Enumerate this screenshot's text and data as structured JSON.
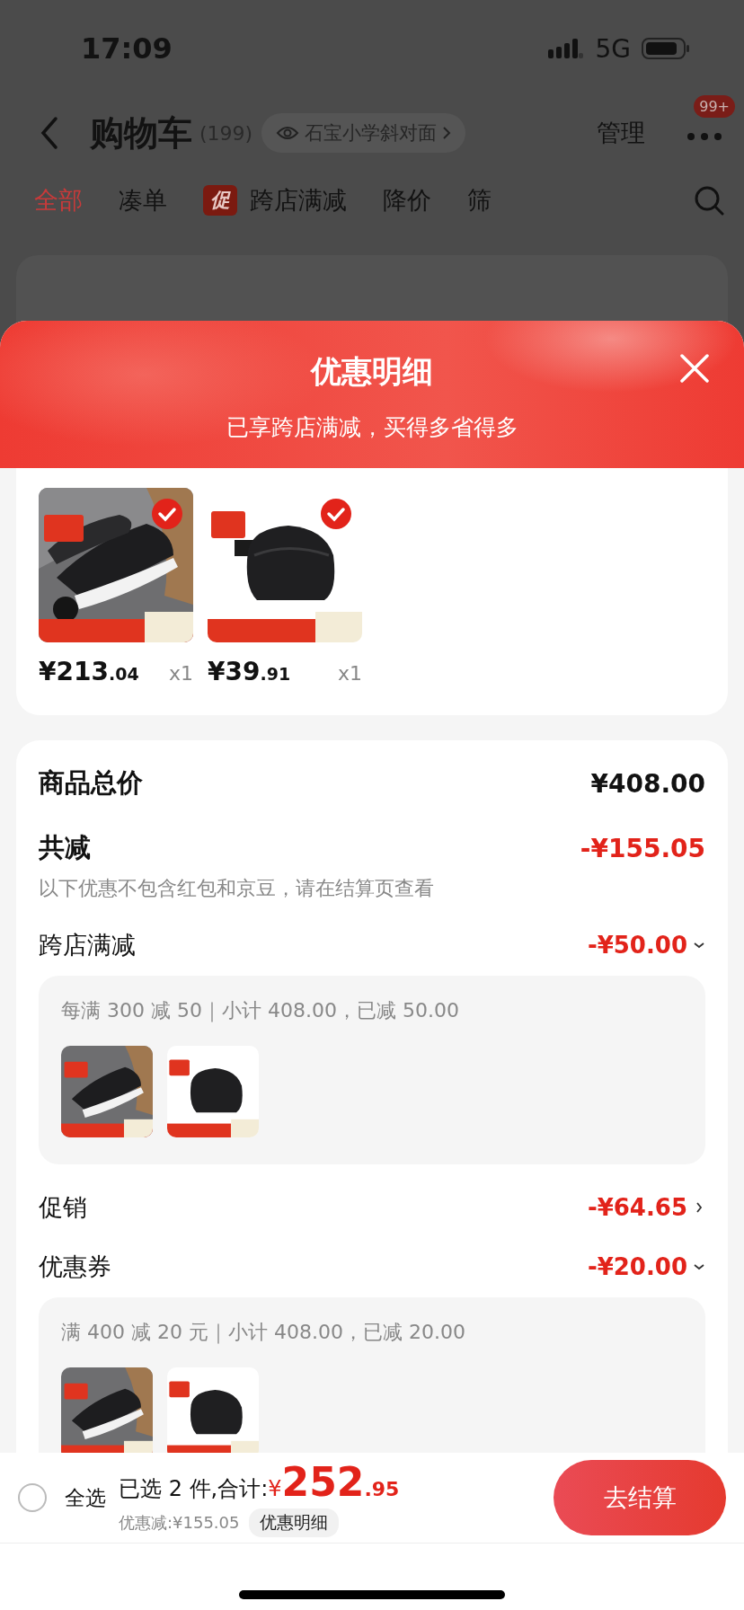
{
  "status_bar": {
    "time": "17:09",
    "network": "5G"
  },
  "nav": {
    "title": "购物车",
    "count": "(199)",
    "location": "石宝小学斜对面",
    "manage": "管理",
    "badge": "99+"
  },
  "tabs": [
    {
      "label": "全部",
      "selected": true
    },
    {
      "label": "凑单",
      "selected": false
    },
    {
      "label": "跨店满减",
      "selected": false,
      "tag": "促"
    },
    {
      "label": "降价",
      "selected": false
    },
    {
      "label": "筛",
      "selected": false
    }
  ],
  "sheet": {
    "title": "优惠明细",
    "subtitle": "已享跨店满减，买得多省得多",
    "products": [
      {
        "kind": "shoe",
        "checked": true,
        "price": "¥213",
        "cents": ".04",
        "qty": "x1"
      },
      {
        "kind": "bag",
        "checked": true,
        "price": "¥39",
        "cents": ".91",
        "qty": "x1"
      }
    ],
    "total": {
      "label": "商品总价",
      "value": "¥408.00"
    },
    "reduction": {
      "label": "共减",
      "value": "-¥155.05",
      "note": "以下优惠不包含红包和京豆，请在结算页查看"
    },
    "discounts": [
      {
        "label": "跨店满减",
        "value": "-¥50.00",
        "expanded": true,
        "detail": "每满 300 减 50｜小计 408.00，已减 50.00"
      },
      {
        "label": "促销",
        "value": "-¥64.65",
        "expanded": false
      },
      {
        "label": "优惠券",
        "value": "-¥20.00",
        "expanded": true,
        "detail": "满 400 减 20 元｜小计 408.00，已减 20.00"
      }
    ]
  },
  "bottom_bar": {
    "select_all": {
      "label": "全选",
      "checked": false
    },
    "summary": "已选 2 件,合计:",
    "currency": "¥",
    "amount": "252",
    "cents": ".95",
    "saved": "优惠减:¥155.05",
    "details_button": "优惠明细",
    "checkout": "去结算"
  }
}
